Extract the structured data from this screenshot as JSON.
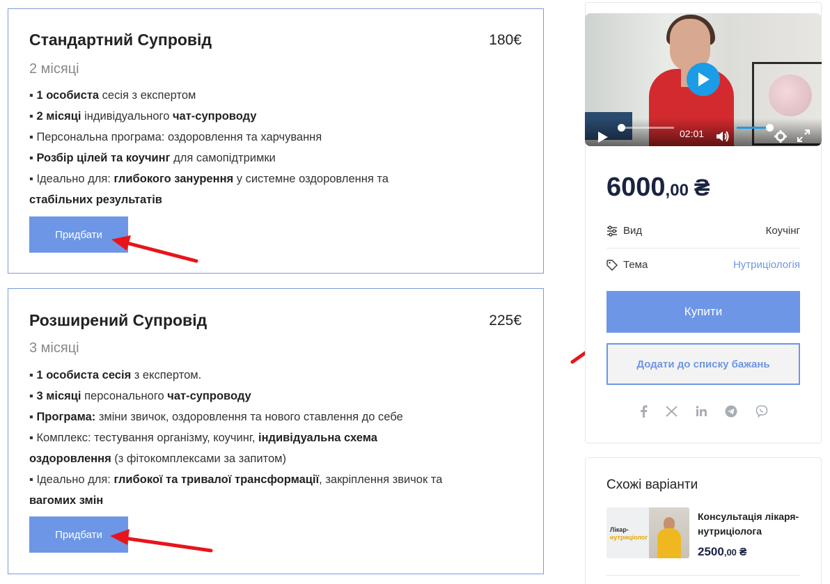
{
  "plans": [
    {
      "title": "Стандартний Супровід",
      "price": "180€",
      "duration": "2 місяці",
      "features": [
        [
          {
            "b": true,
            "t": "1 особиста"
          },
          {
            "b": false,
            "t": " сесія з експертом"
          }
        ],
        [
          {
            "b": true,
            "t": "2 місяці"
          },
          {
            "b": false,
            "t": " індивідуального "
          },
          {
            "b": true,
            "t": "чат-супроводу"
          }
        ],
        [
          {
            "b": false,
            "t": "Персональна програма: оздоровлення та харчування"
          }
        ],
        [
          {
            "b": true,
            "t": "Розбір цілей та коучинг"
          },
          {
            "b": false,
            "t": " для самопідтримки"
          }
        ],
        [
          {
            "b": false,
            "t": "Ідеально для: "
          },
          {
            "b": true,
            "t": "глибокого занурення"
          },
          {
            "b": false,
            "t": " у системне оздоровлення та "
          },
          {
            "b": true,
            "t": "стабільних результатів"
          }
        ]
      ],
      "button": "Придбати"
    },
    {
      "title": "Розширений Супровід",
      "price": "225€",
      "duration": "3 місяці",
      "features": [
        [
          {
            "b": true,
            "t": "1 особиста сесія"
          },
          {
            "b": false,
            "t": " з експертом."
          }
        ],
        [
          {
            "b": true,
            "t": "3 місяці"
          },
          {
            "b": false,
            "t": " персонального "
          },
          {
            "b": true,
            "t": "чат-супроводу"
          }
        ],
        [
          {
            "b": true,
            "t": "Програма:"
          },
          {
            "b": false,
            "t": " зміни звичок, оздоровлення та нового ставлення до себе"
          }
        ],
        [
          {
            "b": false,
            "t": "Комплекс: тестування організму, коучинг, "
          },
          {
            "b": true,
            "t": "індивідуальна схема оздоровлення"
          },
          {
            "b": false,
            "t": " (з фітокомплексами за запитом)"
          }
        ],
        [
          {
            "b": false,
            "t": "Ідеально для: "
          },
          {
            "b": true,
            "t": "глибокої та тривалої трансформації"
          },
          {
            "b": false,
            "t": ", закріплення звичок та "
          },
          {
            "b": true,
            "t": "вагомих змін"
          }
        ]
      ],
      "button": "Придбати"
    }
  ],
  "video": {
    "time": "02:01",
    "progress": 0.0,
    "volume": 0.92,
    "icons": [
      "play-icon",
      "volume-icon",
      "settings-icon",
      "fullscreen-icon"
    ]
  },
  "product": {
    "price_int": "6000",
    "price_dec": ",00",
    "currency": "₴",
    "meta": [
      {
        "label": "Вид",
        "value": "Коучінг",
        "icon": "sliders-icon"
      },
      {
        "label": "Тема",
        "value": "Нутриціологія",
        "icon": "tag-icon"
      }
    ],
    "buy_label": "Купити",
    "wishlist_label": "Додати до списку бажань",
    "share": [
      "facebook-icon",
      "x-icon",
      "linkedin-icon",
      "telegram-icon",
      "viber-icon"
    ]
  },
  "similar": {
    "title": "Схожі варіанти",
    "items": [
      {
        "thumb_text_1": "Лікар-",
        "thumb_text_2": "нутриціолог",
        "name": "Консультація лікаря-нутриціолога",
        "price_int": "2500",
        "price_dec": ",00",
        "currency": "₴"
      }
    ]
  },
  "colors": {
    "accent": "#6d96e6",
    "border": "#7d9bd6",
    "price_dark": "#1a2340",
    "arrow": "#e8141b",
    "video_play": "#1c9ce6"
  }
}
